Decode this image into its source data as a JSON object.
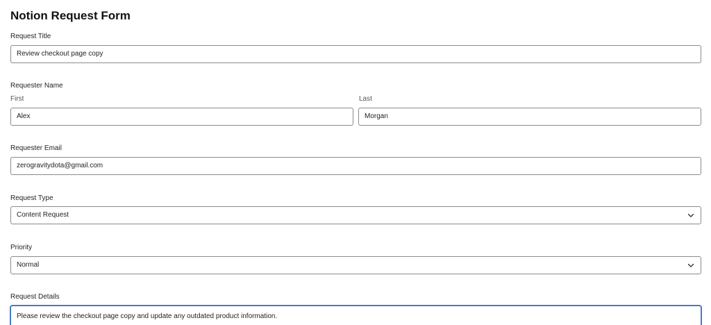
{
  "form": {
    "title": "Notion Request Form"
  },
  "request_title": {
    "label": "Request Title",
    "value": "Review checkout page copy"
  },
  "requester_name": {
    "label": "Requester Name",
    "first_label": "First",
    "first_value": "Alex",
    "last_label": "Last",
    "last_value": "Morgan"
  },
  "requester_email": {
    "label": "Requester Email",
    "value": "zerogravitydota@gmail.com"
  },
  "request_type": {
    "label": "Request Type",
    "selected": "Content Request",
    "icon": "chevron-down-icon"
  },
  "priority": {
    "label": "Priority",
    "selected": "Normal",
    "icon": "chevron-down-icon"
  },
  "request_details": {
    "label": "Request Details",
    "value": "Please review the checkout page copy and update any outdated product information."
  },
  "colors": {
    "border": "#8a8a8a",
    "focus_border": "#4a78c8",
    "text": "#1f1f1f"
  }
}
